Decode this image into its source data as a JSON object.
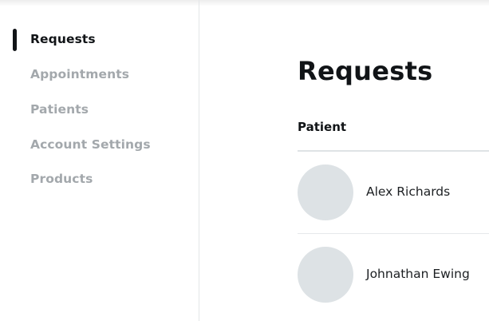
{
  "sidebar": {
    "items": [
      {
        "label": "Requests",
        "active": true
      },
      {
        "label": "Appointments",
        "active": false
      },
      {
        "label": "Patients",
        "active": false
      },
      {
        "label": "Account Settings",
        "active": false
      },
      {
        "label": "Products",
        "active": false
      }
    ]
  },
  "main": {
    "title": "Requests",
    "table": {
      "columns": [
        "Patient"
      ],
      "rows": [
        {
          "name": "Alex Richards"
        },
        {
          "name": "Johnathan Ewing"
        }
      ]
    }
  },
  "colors": {
    "text_primary": "#111417",
    "text_muted": "#a3a8ac",
    "avatar_placeholder": "#dde2e5",
    "divider": "#e3e6e8"
  }
}
